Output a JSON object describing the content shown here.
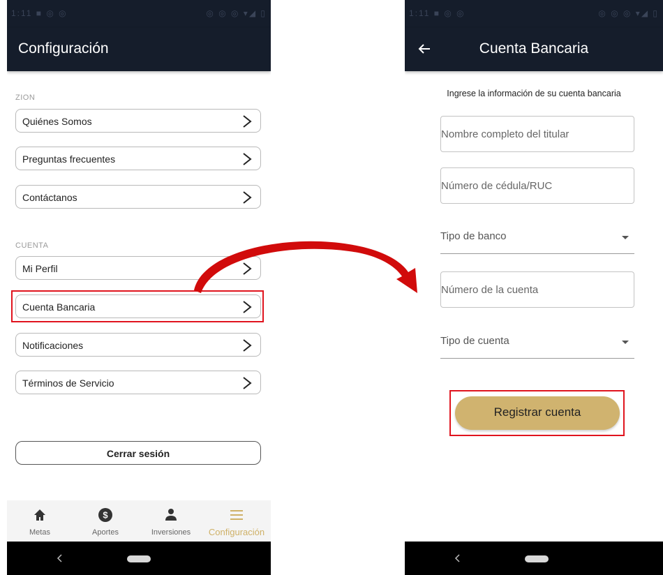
{
  "left_screen": {
    "title": "Configuración",
    "section_zion": "ZION",
    "zion_items": [
      {
        "label": "Quiénes Somos"
      },
      {
        "label": "Preguntas frecuentes"
      },
      {
        "label": "Contáctanos"
      }
    ],
    "section_cuenta": "CUENTA",
    "cuenta_items": [
      {
        "label": "Mi Perfil"
      },
      {
        "label": "Cuenta Bancaria"
      },
      {
        "label": "Notificaciones"
      },
      {
        "label": "Términos de Servicio"
      }
    ],
    "logout_label": "Cerrar sesión",
    "nav": [
      {
        "label": "Metas",
        "icon": "home-icon"
      },
      {
        "label": "Aportes",
        "icon": "dollar-icon"
      },
      {
        "label": "Inversiones",
        "icon": "person-icon"
      },
      {
        "label": "Configuración",
        "icon": "menu-icon",
        "active": true
      }
    ]
  },
  "right_screen": {
    "title": "Cuenta Bancaria",
    "intro": "Ingrese la información de su cuenta bancaria",
    "fields": {
      "holder_name": "Nombre completo del titular",
      "id_number": "Número de cédula/RUC",
      "bank_type": "Tipo de banco",
      "account_number": "Número de la cuenta",
      "account_type": "Tipo de cuenta"
    },
    "register_label": "Registrar cuenta"
  },
  "colors": {
    "app_bar": "#151d2b",
    "accent_gold": "#d0b36f",
    "active_nav": "#cfb168",
    "highlight_red": "#e0141e"
  }
}
